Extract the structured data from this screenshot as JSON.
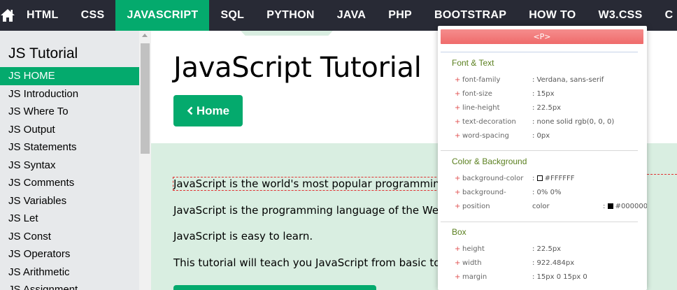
{
  "topnav": {
    "home_icon": "home-icon",
    "items": [
      {
        "label": "HTML",
        "active": false
      },
      {
        "label": "CSS",
        "active": false
      },
      {
        "label": "JAVASCRIPT",
        "active": true
      },
      {
        "label": "SQL",
        "active": false
      },
      {
        "label": "PYTHON",
        "active": false
      },
      {
        "label": "JAVA",
        "active": false
      },
      {
        "label": "PHP",
        "active": false
      },
      {
        "label": "BOOTSTRAP",
        "active": false
      },
      {
        "label": "HOW TO",
        "active": false
      },
      {
        "label": "W3.CSS",
        "active": false
      },
      {
        "label": "C",
        "active": false
      }
    ]
  },
  "sidebar": {
    "title": "JS Tutorial",
    "items": [
      {
        "label": "JS HOME",
        "active": true
      },
      {
        "label": "JS Introduction"
      },
      {
        "label": "JS Where To"
      },
      {
        "label": "JS Output"
      },
      {
        "label": "JS Statements"
      },
      {
        "label": "JS Syntax"
      },
      {
        "label": "JS Comments"
      },
      {
        "label": "JS Variables"
      },
      {
        "label": "JS Let"
      },
      {
        "label": "JS Const"
      },
      {
        "label": "JS Operators"
      },
      {
        "label": "JS Arithmetic"
      },
      {
        "label": "JS Assignment"
      }
    ]
  },
  "main": {
    "title": "JavaScript Tutorial",
    "home_button": {
      "icon": "chevron-left-icon",
      "label": "Home"
    },
    "paragraphs": [
      "JavaScript is the world's most popular programming language.",
      "JavaScript is the programming language of the Web.",
      "JavaScript is easy to learn.",
      "This tutorial will teach you JavaScript from basic to advanced."
    ]
  },
  "inspector": {
    "element_tag": "<P>",
    "sections": [
      {
        "title": "Font & Text",
        "rows": [
          {
            "prop": "font-family",
            "value": ": Verdana, sans-serif"
          },
          {
            "prop": "font-size",
            "value": ": 15px"
          },
          {
            "prop": "line-height",
            "value": ": 22.5px"
          },
          {
            "prop": "text-decoration",
            "value": ": none solid rgb(0, 0, 0)"
          },
          {
            "prop": "word-spacing",
            "value": ": 0px"
          }
        ]
      },
      {
        "title": "Color & Background",
        "rows": [
          {
            "prop": "background-color",
            "value": "#FFFFFF",
            "swatch": "#FFFFFF"
          },
          {
            "prop": "background-",
            "value": ": 0% 0%"
          },
          {
            "prop": "position",
            "value": "color",
            "extra_value": "#000000",
            "extra_swatch": "#000000"
          }
        ]
      },
      {
        "title": "Box",
        "rows": [
          {
            "prop": "height",
            "value": ": 22.5px"
          },
          {
            "prop": "width",
            "value": ": 922.484px"
          },
          {
            "prop": "margin",
            "value": ": 15px 0 15px 0"
          }
        ]
      }
    ]
  },
  "colors": {
    "nav_bg": "#282A35",
    "accent": "#04AA6D",
    "sidebar_bg": "#E7E9EB",
    "intro_bg": "#D9EEE1",
    "inspector_header": "#EF6B6B",
    "section_title": "#5A7F1E"
  }
}
